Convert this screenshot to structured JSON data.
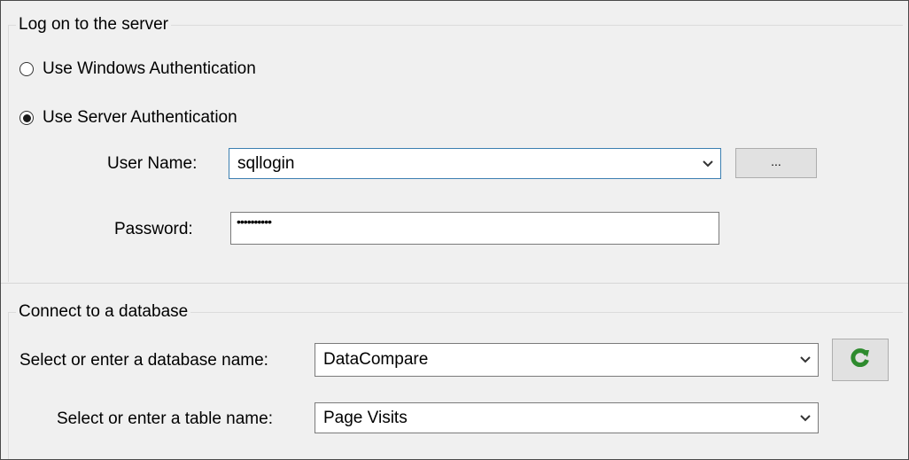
{
  "logon": {
    "group_title": "Log on to the server",
    "windows_auth_label": "Use Windows Authentication",
    "server_auth_label": "Use Server Authentication",
    "selected_auth": "server",
    "username_label": "User Name:",
    "username_value": "sqllogin",
    "browse_label": "...",
    "password_label": "Password:",
    "password_mask": "••••••••••"
  },
  "database": {
    "group_title": "Connect to a database",
    "db_label": "Select or enter a database name:",
    "db_value": "DataCompare",
    "table_label": "Select or enter a table name:",
    "table_value": "Page Visits"
  },
  "icons": {
    "dropdown": "chevron-down-icon",
    "refresh": "refresh-icon"
  },
  "colors": {
    "refresh_green": "#2e8b2e",
    "focus_border": "#3c7fb1"
  }
}
